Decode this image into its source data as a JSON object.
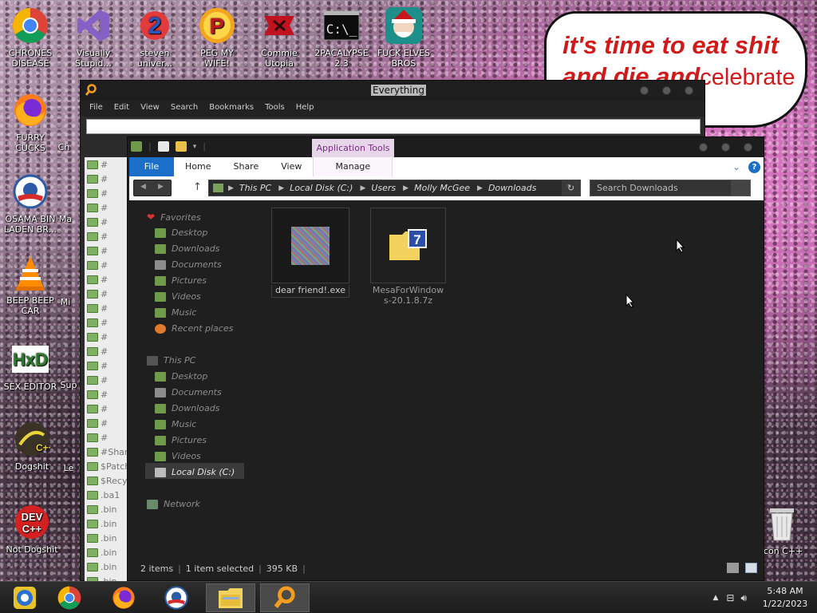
{
  "desktop": {
    "icons": [
      {
        "label": "CHRONES DISEASE",
        "icon": "chrome-icon"
      },
      {
        "label": "Visually Stupid...",
        "icon": "visual-studio-icon"
      },
      {
        "label": "steven univer...",
        "icon": "steven-universe-icon"
      },
      {
        "label": "PEG MY WIFE!",
        "icon": "peggle-icon"
      },
      {
        "label": "Commie Utopia",
        "icon": "commie-icon"
      },
      {
        "label": "2PACALYPSE 2.3",
        "icon": "console-icon"
      },
      {
        "label": "FUCK ELVES BROS",
        "icon": "elf-icon"
      },
      {
        "label": "FURRY CUCKS",
        "icon": "firefox-icon"
      },
      {
        "label": "OSAMA BIN LADEN BR...",
        "icon": "obama-icon"
      },
      {
        "label": "BEEP BEEP CAR",
        "icon": "vlc-icon"
      },
      {
        "label": "SEX EDITOR",
        "icon": "hxd-icon"
      },
      {
        "label": "Dogshit",
        "icon": "cpp-icon"
      },
      {
        "label": "Not Dogshit",
        "icon": "devcpp-icon"
      },
      {
        "label": "Icon C++",
        "icon": "recycle-bin-icon"
      }
    ],
    "partial_labels": [
      "Ch",
      "Ma",
      "Mi",
      "Sup",
      "Le",
      "M",
      "I"
    ],
    "bubble": {
      "line1": "it's time to eat shit",
      "line2": "and die and",
      "line2_tail": "celebrate"
    }
  },
  "everything_window": {
    "title": "Everything",
    "menu": [
      "File",
      "Edit",
      "View",
      "Search",
      "Bookmarks",
      "Tools",
      "Help"
    ],
    "search_value": "",
    "list": [
      "#",
      "#",
      "#",
      "#",
      "#",
      "#",
      "#",
      "#",
      "#",
      "#",
      "#",
      "#",
      "#",
      "#",
      "#",
      "#",
      "#",
      "#",
      "#",
      "#",
      "#Share",
      "$Patch",
      "$Recy",
      ".ba1",
      ".bin",
      ".bin",
      ".bin",
      ".bin",
      ".bin",
      ".bin",
      ".bin",
      ".bin",
      ".bin"
    ]
  },
  "explorer": {
    "contextual_tab": "Application Tools",
    "ribbon_tabs": {
      "file": "File",
      "home": "Home",
      "share": "Share",
      "view": "View",
      "manage": "Manage"
    },
    "help": "?",
    "address": [
      "This PC",
      "Local Disk (C:)",
      "Users",
      "Molly McGee",
      "Downloads"
    ],
    "search_placeholder": "Search Downloads",
    "nav": {
      "favorites": "Favorites",
      "fav_items": [
        "Desktop",
        "Downloads",
        "Documents",
        "Pictures",
        "Videos",
        "Music",
        "Recent places"
      ],
      "this_pc": "This PC",
      "pc_items": [
        "Desktop",
        "Documents",
        "Downloads",
        "Music",
        "Pictures",
        "Videos",
        "Local Disk (C:)"
      ],
      "network": "Network"
    },
    "files": [
      {
        "name": "dear friend!.exe",
        "selected": true
      },
      {
        "name": "MesaForWindows-20.1.8.7z",
        "name_line1": "MesaForWindow",
        "name_line2": "s-20.1.8.7z",
        "selected": false
      }
    ],
    "status": {
      "items": "2 items",
      "selected": "1 item selected",
      "size": "395 KB"
    }
  },
  "taskbar": {
    "apps": [
      "start-icon",
      "chrome-icon",
      "firefox-icon",
      "obama-icon",
      "file-explorer-icon",
      "everything-icon"
    ],
    "time": "5:48 AM",
    "date": "1/22/2023"
  }
}
